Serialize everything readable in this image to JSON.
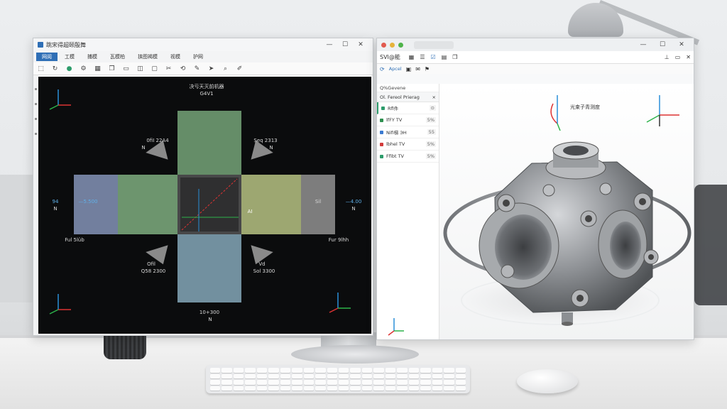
{
  "left_window": {
    "title": "跳宋得超颐殷舞",
    "menu": [
      "网阅",
      "工模",
      "捕模",
      "瓦模柏",
      "挟图褐模",
      "视模",
      "护网"
    ],
    "active_menu_index": 0,
    "toolbar_icons": [
      "select-icon",
      "rotate-icon",
      "sphere-icon",
      "settings-icon",
      "grid-icon",
      "copy-icon",
      "folder-icon",
      "layers-icon",
      "page-icon",
      "cut-icon",
      "rotate-icon",
      "brush-icon",
      "pointer-icon",
      "search-icon",
      "edit-icon"
    ],
    "canvas": {
      "top_title": "决亏天灭前机器",
      "top_sub": "G4V1",
      "labels": {
        "upper_left": "0fiI 22A4",
        "upper_left_sub": "N",
        "upper_right": "Seq 2313",
        "upper_right_sub": "N",
        "mid_left": "94",
        "mid_left_sub": "—5.500",
        "mid_left_n": "N",
        "mid_right": "Sil",
        "mid_right_sub": "—4.00",
        "mid_right_n": "N",
        "low_left_corner": "Ful 5lüb",
        "low_right_corner": "Fur 9lhh",
        "low_left": "Ofil",
        "low_left_sub": "Q58 2300",
        "low_right": "Vd",
        "low_right_sub": "Sol 3300",
        "bottom": "10+300",
        "bottom_sub": "N",
        "center_right": "AI"
      },
      "face_colors": {
        "top": "#7fb283",
        "left": "#8fa0c8",
        "center_left": "#89bd8a",
        "center_right": "#c6d38e",
        "right": "#9e9e9e",
        "bottom": "#8fb6c9",
        "core": "#3a3a3a"
      }
    }
  },
  "right_window": {
    "toolbar_label": "SVl@能",
    "tree_header": "Q%Gevene",
    "panel_title": "Ol. Fereol Prierag",
    "panel_close": "×",
    "rows": [
      {
        "name": "Rfl件",
        "value": "⊙",
        "color": "#2d9c6b"
      },
      {
        "name": "lfFY TV",
        "value": "5%",
        "color": "#2e8f4f"
      },
      {
        "name": "Nifi梯 ЭH",
        "value": "55",
        "color": "#3b7bd1"
      },
      {
        "name": "lbhel TV",
        "value": "5%",
        "color": "#d23b3b"
      },
      {
        "name": "Ffibt TV",
        "value": "5%",
        "color": "#2d9c6b"
      }
    ],
    "viewport_label": "光束子青测度",
    "accent": "#2f6fb6"
  }
}
